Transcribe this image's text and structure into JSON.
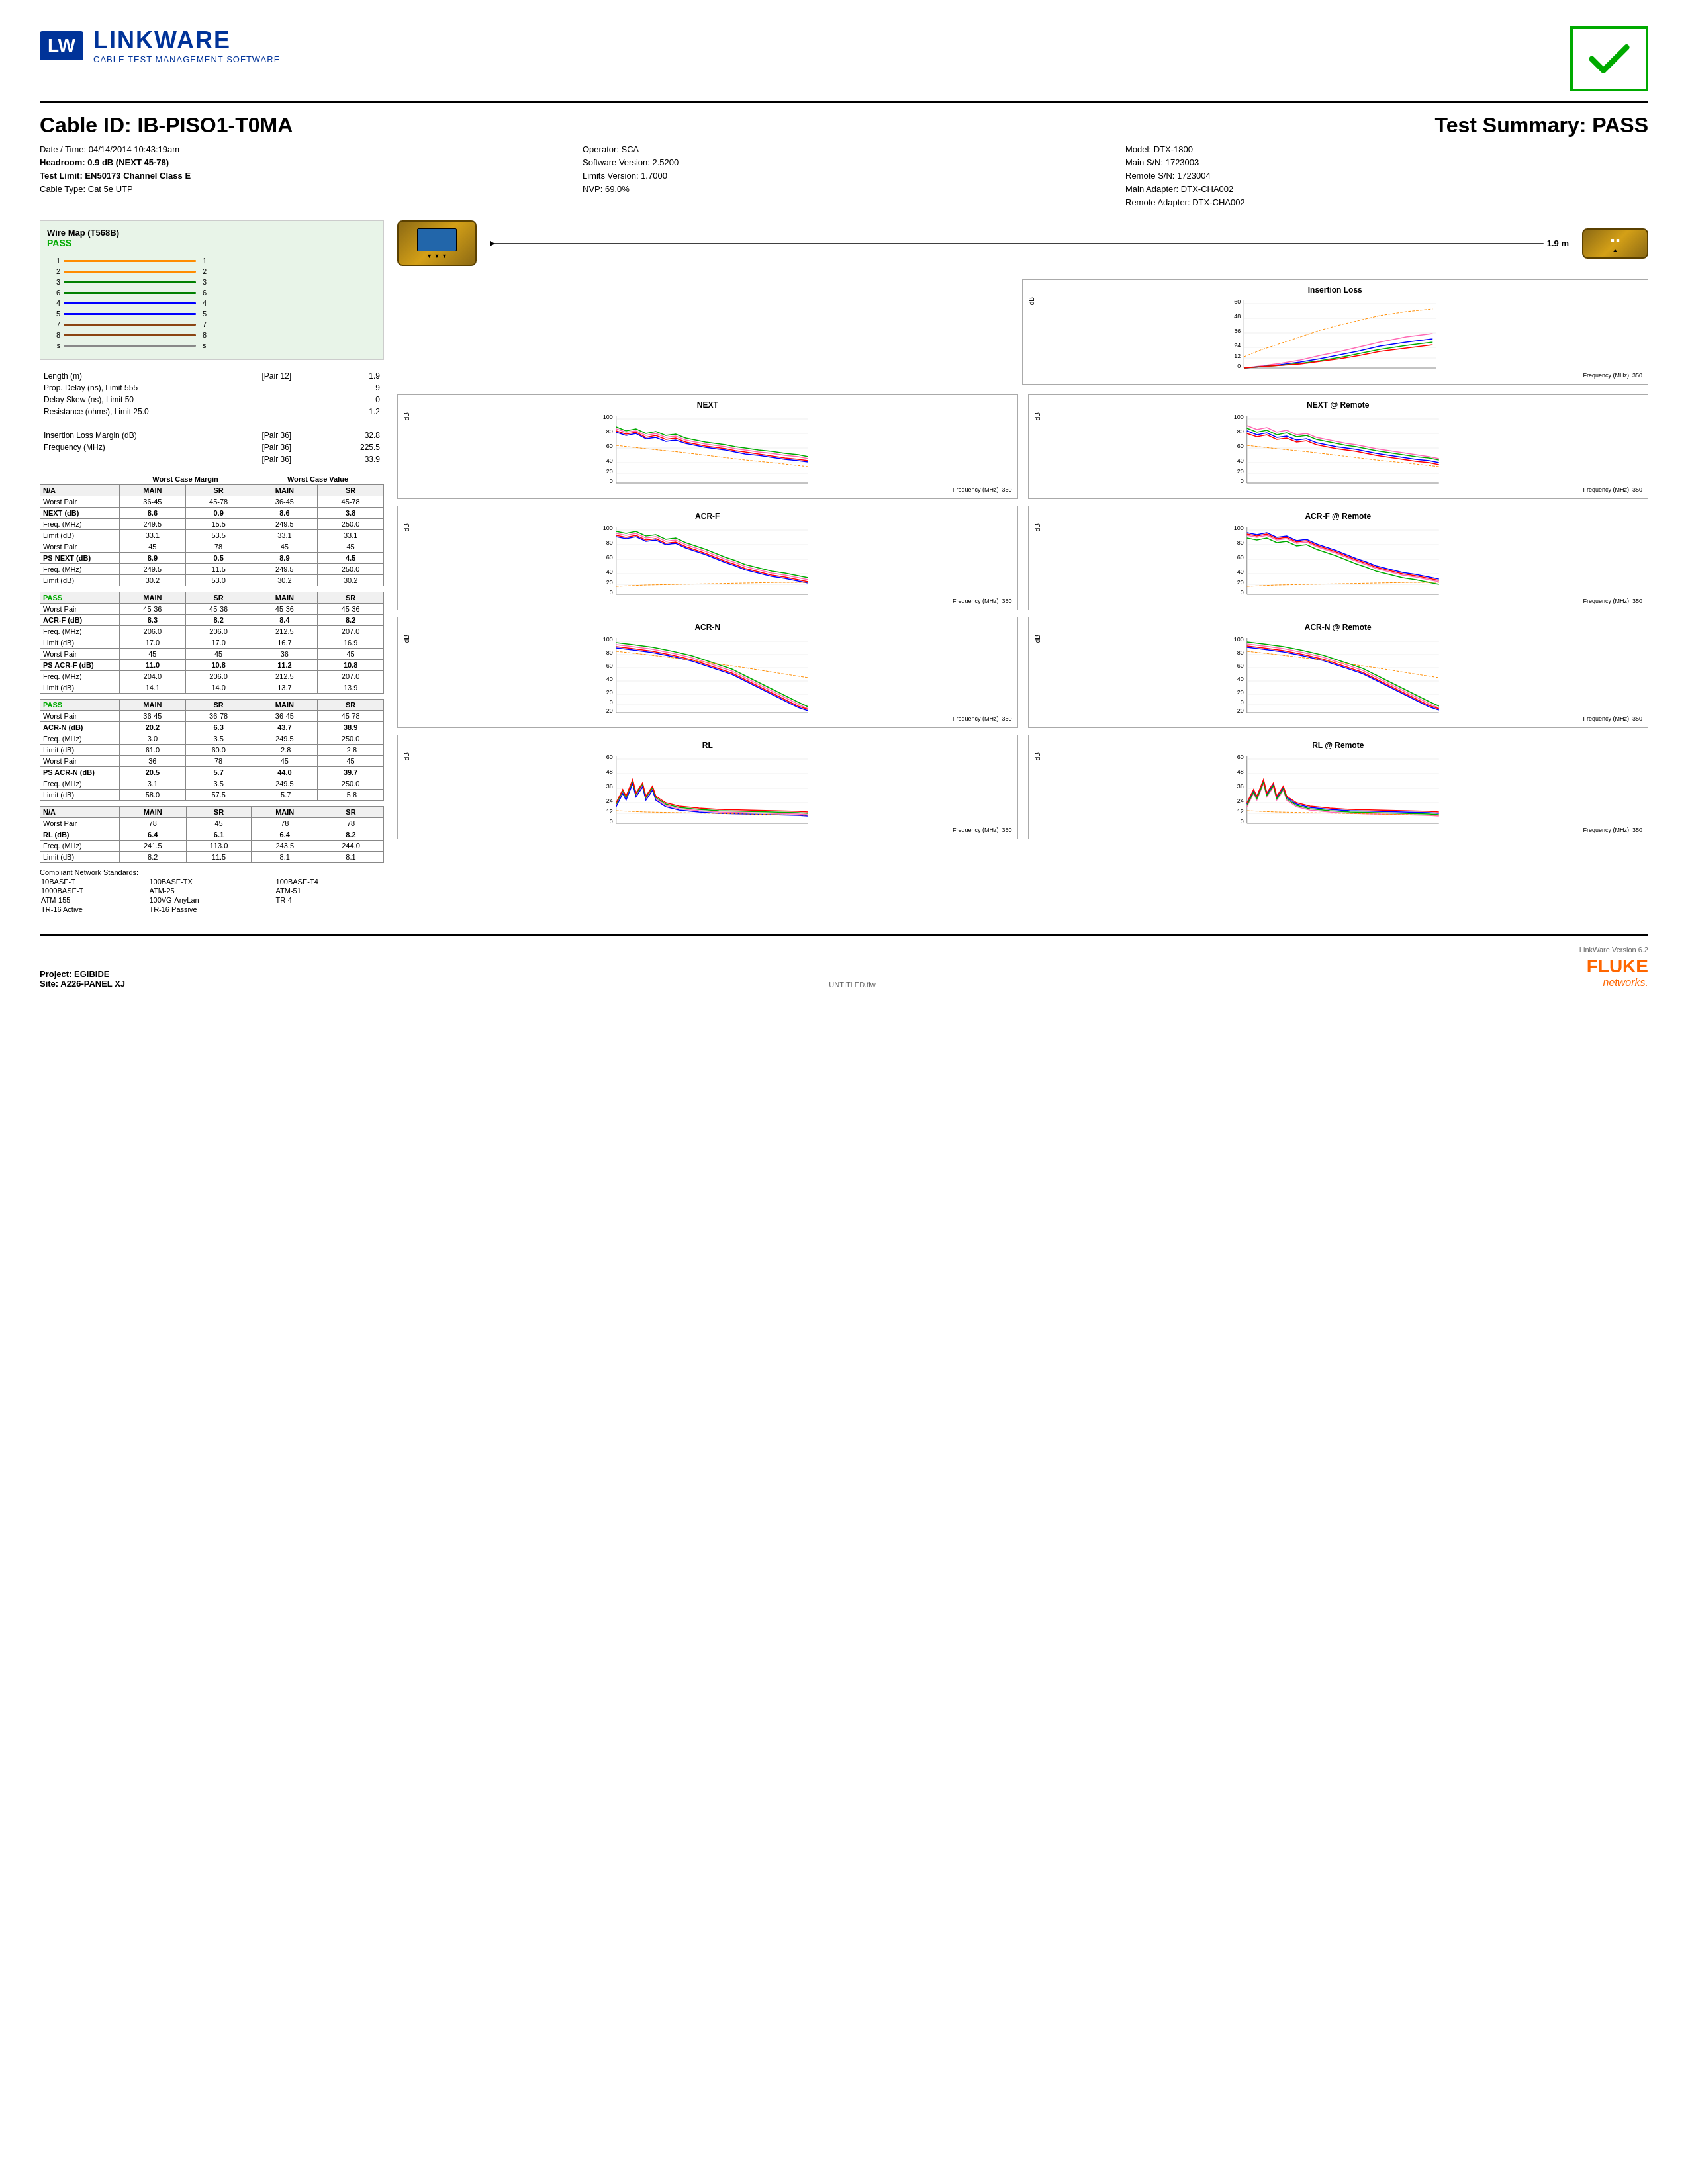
{
  "header": {
    "logo_lw": "LW",
    "logo_name": "LINKWARE",
    "logo_sub": "CABLE TEST MANAGEMENT SOFTWARE",
    "pass_check": "✓"
  },
  "title": {
    "cable_id_label": "Cable ID: IB-PISO1-T0MA",
    "test_summary_label": "Test Summary: PASS"
  },
  "info": {
    "date": "Date / Time: 04/14/2014 10:43:19am",
    "headroom": "Headroom: 0.9 dB (NEXT 45-78)",
    "test_limit": "Test Limit: EN50173 Channel Class E",
    "cable_type": "Cable Type: Cat 5e UTP",
    "operator": "Operator: SCA",
    "software": "Software Version: 2.5200",
    "limits": "Limits Version: 1.7000",
    "nvp": "NVP: 69.0%",
    "model": "Model: DTX-1800",
    "main_sn": "Main S/N: 1723003",
    "remote_sn": "Remote S/N: 1723004",
    "main_adapter": "Main Adapter: DTX-CHA002",
    "remote_adapter": "Remote Adapter: DTX-CHA002"
  },
  "wire_map": {
    "title": "Wire Map (T568B)",
    "status": "PASS",
    "pairs": [
      {
        "left": "1",
        "right": "1",
        "color": "#FF8C00"
      },
      {
        "left": "2",
        "right": "2",
        "color": "#FF8C00"
      },
      {
        "left": "3",
        "right": "3",
        "color": "#008000"
      },
      {
        "left": "6",
        "right": "6",
        "color": "#008000"
      },
      {
        "left": "4",
        "right": "4",
        "color": "#0000FF"
      },
      {
        "left": "5",
        "right": "5",
        "color": "#0000FF"
      },
      {
        "left": "7",
        "right": "7",
        "color": "#8B4513"
      },
      {
        "left": "8",
        "right": "8",
        "color": "#8B4513"
      },
      {
        "left": "s",
        "right": "s",
        "color": "#888888"
      }
    ]
  },
  "measurements": {
    "length_label": "Length (m)",
    "pair12_label": "[Pair 12]",
    "pair12_val": "1.9",
    "length_val": "1.9",
    "prop_delay_label": "Prop. Delay (ns), Limit 555",
    "prop_delay_val": "9",
    "delay_skew_label": "Delay Skew (ns), Limit 50",
    "delay_skew_val": "0",
    "resistance_label": "Resistance (ohms), Limit 25.0",
    "resistance_val": "1.2",
    "insertion_margin_label": "Insertion Loss Margin (dB)",
    "insertion_margin_pair": "[Pair 36]",
    "insertion_margin_val": "32.8",
    "freq_label": "Frequency (MHz)",
    "freq_pair": "[Pair 36]",
    "freq_val": "225.5",
    "freq_val2": "33.9",
    "freq_pair2": "[Pair 36]"
  },
  "distance_display": "1.9 m",
  "stats": {
    "sections": [
      {
        "badge": "N/A",
        "badge_type": "na",
        "headers": [
          "",
          "Worst Case Margin",
          "",
          "Worst Case Value",
          ""
        ],
        "sub_headers": [
          "",
          "MAIN",
          "SR",
          "MAIN",
          "SR"
        ],
        "rows": [
          {
            "label": "Worst Pair",
            "m1": "36-45",
            "s1": "45-78",
            "m2": "36-45",
            "s2": "45-78",
            "bold": false
          },
          {
            "label": "NEXT (dB)",
            "m1": "8.6",
            "s1": "0.9",
            "m2": "8.6",
            "s2": "3.8",
            "bold": true
          },
          {
            "label": "Freq. (MHz)",
            "m1": "249.5",
            "s1": "15.5",
            "m2": "249.5",
            "s2": "250.0",
            "bold": false
          },
          {
            "label": "Limit (dB)",
            "m1": "33.1",
            "s1": "53.5",
            "m2": "33.1",
            "s2": "33.1",
            "bold": false
          },
          {
            "label": "Worst Pair",
            "m1": "45",
            "s1": "78",
            "m2": "45",
            "s2": "45",
            "bold": false
          },
          {
            "label": "PS NEXT (dB)",
            "m1": "8.9",
            "s1": "0.5",
            "m2": "8.9",
            "s2": "4.5",
            "bold": true
          },
          {
            "label": "Freq. (MHz)",
            "m1": "249.5",
            "s1": "11.5",
            "m2": "249.5",
            "s2": "250.0",
            "bold": false
          },
          {
            "label": "Limit (dB)",
            "m1": "30.2",
            "s1": "53.0",
            "m2": "30.2",
            "s2": "30.2",
            "bold": false
          }
        ]
      },
      {
        "badge": "PASS",
        "badge_type": "pass",
        "sub_headers": [
          "",
          "MAIN",
          "SR",
          "MAIN",
          "SR"
        ],
        "rows": [
          {
            "label": "Worst Pair",
            "m1": "45-36",
            "s1": "45-36",
            "m2": "45-36",
            "s2": "45-36",
            "bold": false
          },
          {
            "label": "ACR-F (dB)",
            "m1": "8.3",
            "s1": "8.2",
            "m2": "8.4",
            "s2": "8.2",
            "bold": true
          },
          {
            "label": "Freq. (MHz)",
            "m1": "206.0",
            "s1": "206.0",
            "m2": "212.5",
            "s2": "207.0",
            "bold": false
          },
          {
            "label": "Limit (dB)",
            "m1": "17.0",
            "s1": "17.0",
            "m2": "16.7",
            "s2": "16.9",
            "bold": false
          },
          {
            "label": "Worst Pair",
            "m1": "45",
            "s1": "45",
            "m2": "36",
            "s2": "45",
            "bold": false
          },
          {
            "label": "PS ACR-F (dB)",
            "m1": "11.0",
            "s1": "10.8",
            "m2": "11.2",
            "s2": "10.8",
            "bold": true
          },
          {
            "label": "Freq. (MHz)",
            "m1": "204.0",
            "s1": "206.0",
            "m2": "212.5",
            "s2": "207.0",
            "bold": false
          },
          {
            "label": "Limit (dB)",
            "m1": "14.1",
            "s1": "14.0",
            "m2": "13.7",
            "s2": "13.9",
            "bold": false
          }
        ]
      },
      {
        "badge": "PASS",
        "badge_type": "pass",
        "sub_headers": [
          "",
          "MAIN",
          "SR",
          "MAIN",
          "SR"
        ],
        "rows": [
          {
            "label": "Worst Pair",
            "m1": "36-45",
            "s1": "36-78",
            "m2": "36-45",
            "s2": "45-78",
            "bold": false
          },
          {
            "label": "ACR-N (dB)",
            "m1": "20.2",
            "s1": "6.3",
            "m2": "43.7",
            "s2": "38.9",
            "bold": true
          },
          {
            "label": "Freq. (MHz)",
            "m1": "3.0",
            "s1": "3.5",
            "m2": "249.5",
            "s2": "250.0",
            "bold": false
          },
          {
            "label": "Limit (dB)",
            "m1": "61.0",
            "s1": "60.0",
            "m2": "-2.8",
            "s2": "-2.8",
            "bold": false
          },
          {
            "label": "Worst Pair",
            "m1": "36",
            "s1": "78",
            "m2": "45",
            "s2": "45",
            "bold": false
          },
          {
            "label": "PS ACR-N (dB)",
            "m1": "20.5",
            "s1": "5.7",
            "m2": "44.0",
            "s2": "39.7",
            "bold": true
          },
          {
            "label": "Freq. (MHz)",
            "m1": "3.1",
            "s1": "3.5",
            "m2": "249.5",
            "s2": "250.0",
            "bold": false
          },
          {
            "label": "Limit (dB)",
            "m1": "58.0",
            "s1": "57.5",
            "m2": "-5.7",
            "s2": "-5.8",
            "bold": false
          }
        ]
      },
      {
        "badge": "N/A",
        "badge_type": "na",
        "sub_headers": [
          "",
          "MAIN",
          "SR",
          "MAIN",
          "SR"
        ],
        "rows": [
          {
            "label": "Worst Pair",
            "m1": "78",
            "s1": "45",
            "m2": "78",
            "s2": "78",
            "bold": false
          },
          {
            "label": "RL (dB)",
            "m1": "6.4",
            "s1": "6.1",
            "m2": "6.4",
            "s2": "8.2",
            "bold": true
          },
          {
            "label": "Freq. (MHz)",
            "m1": "241.5",
            "s1": "113.0",
            "m2": "243.5",
            "s2": "244.0",
            "bold": false
          },
          {
            "label": "Limit (dB)",
            "m1": "8.2",
            "s1": "11.5",
            "m2": "8.1",
            "s2": "8.1",
            "bold": false
          }
        ]
      }
    ]
  },
  "network_standards": {
    "label": "Compliant Network Standards:",
    "items": [
      [
        "10BASE-T",
        "100BASE-TX",
        "100BASE-T4"
      ],
      [
        "1000BASE-T",
        "ATM-25",
        "ATM-51"
      ],
      [
        "ATM-155",
        "100VG-AnyLan",
        "TR-4"
      ],
      [
        "TR-16 Active",
        "TR-16 Passive",
        ""
      ]
    ]
  },
  "charts": {
    "insertion_loss": {
      "title": "Insertion Loss",
      "y_max": "60",
      "y_min": "0",
      "x_max": "350",
      "x_label": "Frequency (MHz)",
      "y_label": "dB"
    },
    "next": {
      "title": "NEXT",
      "y_max": "100",
      "y_min": "0",
      "x_max": "350",
      "x_label": "Frequency (MHz)",
      "y_label": "dB"
    },
    "next_remote": {
      "title": "NEXT @ Remote",
      "y_max": "100",
      "y_min": "0",
      "x_max": "350",
      "x_label": "Frequency (MHz)",
      "y_label": "dB"
    },
    "acr_f": {
      "title": "ACR-F",
      "y_max": "100",
      "y_min": "0",
      "x_max": "350",
      "x_label": "Frequency (MHz)",
      "y_label": "dB"
    },
    "acr_f_remote": {
      "title": "ACR-F @ Remote",
      "y_max": "100",
      "y_min": "0",
      "x_max": "350",
      "x_label": "Frequency (MHz)",
      "y_label": "dB"
    },
    "acr_n": {
      "title": "ACR-N",
      "y_max": "100",
      "y_min": "0",
      "y_min_label": "-20",
      "x_max": "350",
      "x_label": "Frequency (MHz)",
      "y_label": "dB"
    },
    "acr_n_remote": {
      "title": "ACR-N @ Remote",
      "y_max": "100",
      "y_min": "0",
      "y_min_label": "-20",
      "x_max": "350",
      "x_label": "Frequency (MHz)",
      "y_label": "dB"
    },
    "rl": {
      "title": "RL",
      "y_max": "60",
      "y_min": "0",
      "x_max": "350",
      "x_label": "Frequency (MHz)",
      "y_label": "dB"
    },
    "rl_remote": {
      "title": "RL @ Remote",
      "y_max": "60",
      "y_min": "0",
      "x_max": "350",
      "x_label": "Frequency (MHz)",
      "y_label": "dB"
    }
  },
  "footer": {
    "project": "Project: EGIBIDE",
    "site": "Site: A226-PANEL XJ",
    "filename": "UNTITLED.flw",
    "linkware_version": "LinkWare Version  6.2",
    "fluke": "FLUKE",
    "networks": "networks."
  }
}
